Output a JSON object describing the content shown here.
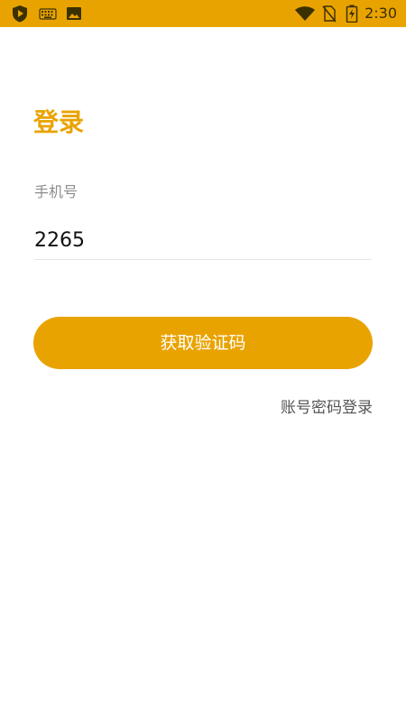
{
  "status_bar": {
    "time": "2:30",
    "left_icons": [
      "shield-play-icon",
      "keyboard-icon",
      "image-icon"
    ],
    "right_icons": [
      "wifi-icon",
      "no-sim-icon",
      "battery-charging-icon"
    ],
    "background_color": "#E9A300"
  },
  "login": {
    "title": "登录",
    "phone_label": "手机号",
    "phone_value": "2265",
    "get_code_button": "获取验证码",
    "account_password_link": "账号密码登录",
    "accent_color": "#E9A300"
  }
}
